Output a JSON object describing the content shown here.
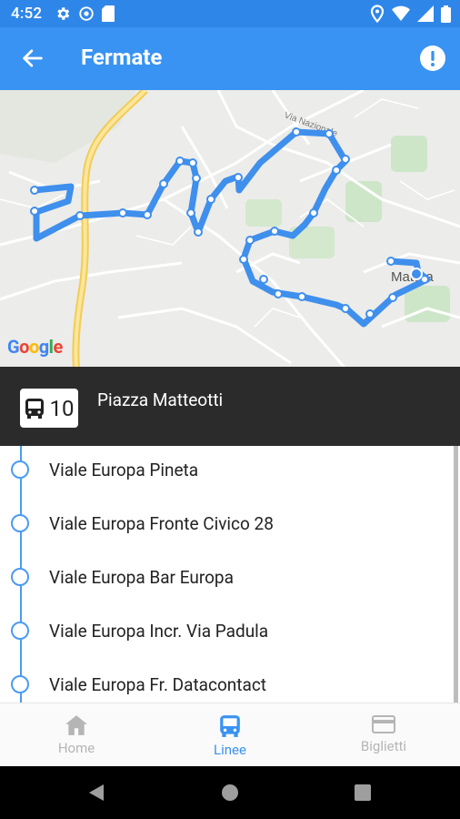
{
  "status_bar": {
    "time": "4:52"
  },
  "app_bar": {
    "title": "Fermate"
  },
  "map": {
    "attribution": "Google",
    "labels": [
      "Via Nazionale",
      "Matera"
    ]
  },
  "current_stop": {
    "line_number": "10",
    "name": "Piazza Matteotti"
  },
  "stops": [
    "Viale Europa Pineta",
    "Viale Europa Fronte Civico 28",
    "Viale Europa Bar Europa",
    "Viale Europa Incr. Via Padula",
    "Viale Europa Fr. Datacontact"
  ],
  "bottom_nav": {
    "home": "Home",
    "linee": "Linee",
    "biglietti": "Biglietti"
  },
  "colors": {
    "accent": "#3993f2",
    "route": "#3f8fed",
    "inactive_tab": "#b5b5b5"
  }
}
